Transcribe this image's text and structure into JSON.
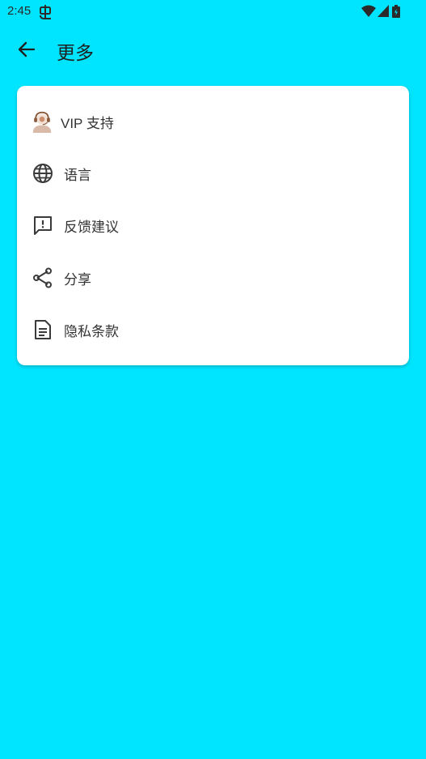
{
  "status_bar": {
    "time": "2:45",
    "icons": [
      "debug-icon",
      "wifi-icon",
      "signal-icon",
      "battery-icon"
    ]
  },
  "app_bar": {
    "back_icon": "arrow-left-icon",
    "title": "更多"
  },
  "menu": {
    "items": [
      {
        "id": "vip-support",
        "label": "VIP 支持",
        "icon": "support-agent-icon"
      },
      {
        "id": "language",
        "label": "语言",
        "icon": "globe-icon"
      },
      {
        "id": "feedback",
        "label": "反馈建议",
        "icon": "feedback-icon"
      },
      {
        "id": "share",
        "label": "分享",
        "icon": "share-icon"
      },
      {
        "id": "privacy",
        "label": "隐私条款",
        "icon": "document-icon"
      }
    ]
  },
  "colors": {
    "background": "#00E5FF",
    "card": "#FFFFFF",
    "text": "#333333",
    "icon": "#3a3a3a"
  }
}
